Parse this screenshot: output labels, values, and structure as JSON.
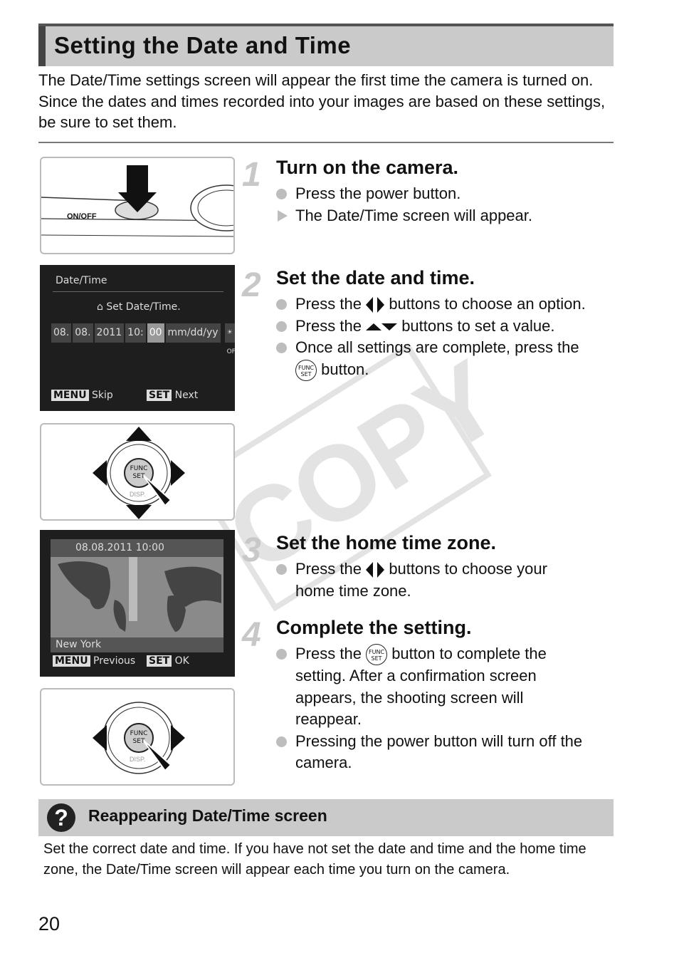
{
  "title": "Setting the Date and Time",
  "intro": "The Date/Time settings screen will appear the first time the camera is turned on. Since the dates and times recorded into your images are based on these settings, be sure to set them.",
  "watermark": "COPY",
  "figure1": {
    "label": "ON/OFF"
  },
  "screen1": {
    "header": "Date/Time",
    "prompt": "Set Date/Time.",
    "month": "08.",
    "day": "08.",
    "year": "2011",
    "hour": "10:",
    "minute": "00",
    "format": "mm/dd/yy",
    "dst": "OFF",
    "menu_key": "MENU",
    "menu_label": "Skip",
    "set_key": "SET",
    "set_label": "Next"
  },
  "dial": {
    "center_top": "FUNC",
    "center_bottom": "SET",
    "bottom": "DISP."
  },
  "screen2": {
    "datetime": "08.08.2011 10:00",
    "zone": "New York",
    "menu_key": "MENU",
    "menu_label": "Previous",
    "set_key": "SET",
    "set_label": "OK"
  },
  "func_icon": {
    "top": "FUNC",
    "bottom": "SET"
  },
  "steps": [
    {
      "num": "1",
      "heading": "Turn on the camera.",
      "items": [
        "Press the power button.",
        "The Date/Time screen will appear."
      ]
    },
    {
      "num": "2",
      "heading": "Set the date and time.",
      "items": [
        {
          "pre": "Press the",
          "post": "buttons to choose an option."
        },
        {
          "pre": "Press the",
          "post": "buttons to set a value."
        },
        {
          "pre": "Once all settings are complete, press the",
          "post": "button."
        }
      ]
    },
    {
      "num": "3",
      "heading": "Set the home time zone.",
      "items": [
        {
          "pre": "Press the",
          "post": "buttons to choose your home time zone."
        }
      ]
    },
    {
      "num": "4",
      "heading": "Complete the setting.",
      "items": [
        {
          "pre": "Press the",
          "post": "button to complete the setting. After a confirmation screen appears, the shooting screen will reappear."
        },
        "Pressing the power button will turn off the camera."
      ]
    }
  ],
  "tip": {
    "icon": "question-icon",
    "heading": "Reappearing Date/Time screen",
    "text": "Set the correct date and time. If you have not set the date and time and the home time zone, the Date/Time screen will appear each time you turn on the camera."
  },
  "page_number": "20"
}
